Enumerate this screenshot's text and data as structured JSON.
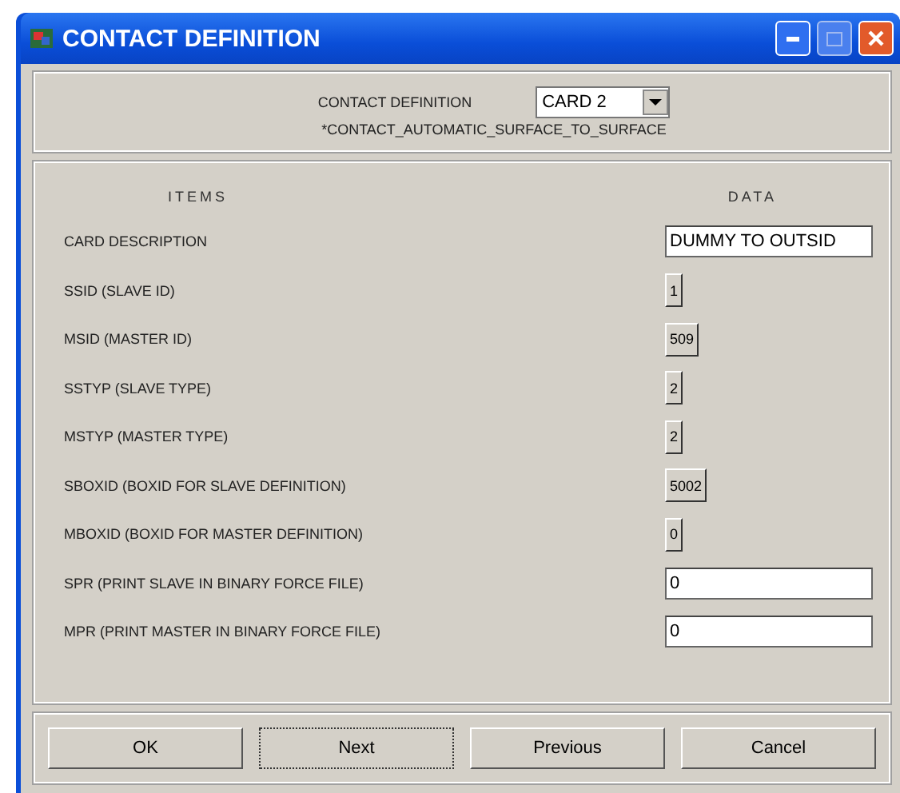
{
  "window": {
    "title": "CONTACT DEFINITION"
  },
  "header": {
    "label": "CONTACT DEFINITION",
    "dropdown_value": "CARD 2",
    "keyword": "*CONTACT_AUTOMATIC_SURFACE_TO_SURFACE"
  },
  "table": {
    "columns": [
      "ITEMS",
      "DATA"
    ],
    "rows": [
      {
        "item": "CARD DESCRIPTION",
        "kind": "field",
        "value": "DUMMY TO OUTSID"
      },
      {
        "item": "SSID (SLAVE ID)",
        "kind": "button",
        "value": "1"
      },
      {
        "item": "MSID (MASTER ID)",
        "kind": "button",
        "value": "509"
      },
      {
        "item": "SSTYP (SLAVE TYPE)",
        "kind": "button",
        "value": "2"
      },
      {
        "item": "MSTYP (MASTER TYPE)",
        "kind": "button",
        "value": "2"
      },
      {
        "item": "SBOXID (BOXID FOR SLAVE DEFINITION)",
        "kind": "button",
        "value": "5002"
      },
      {
        "item": "MBOXID (BOXID FOR MASTER DEFINITION)",
        "kind": "button",
        "value": "0"
      },
      {
        "item": "SPR (PRINT SLAVE IN BINARY FORCE FILE)",
        "kind": "field",
        "value": "0"
      },
      {
        "item": "MPR (PRINT MASTER IN BINARY FORCE FILE)",
        "kind": "field",
        "value": "0"
      }
    ]
  },
  "buttons": [
    {
      "label": "OK",
      "focused": false
    },
    {
      "label": "Next",
      "focused": true
    },
    {
      "label": "Previous",
      "focused": false
    },
    {
      "label": "Cancel",
      "focused": false
    }
  ]
}
